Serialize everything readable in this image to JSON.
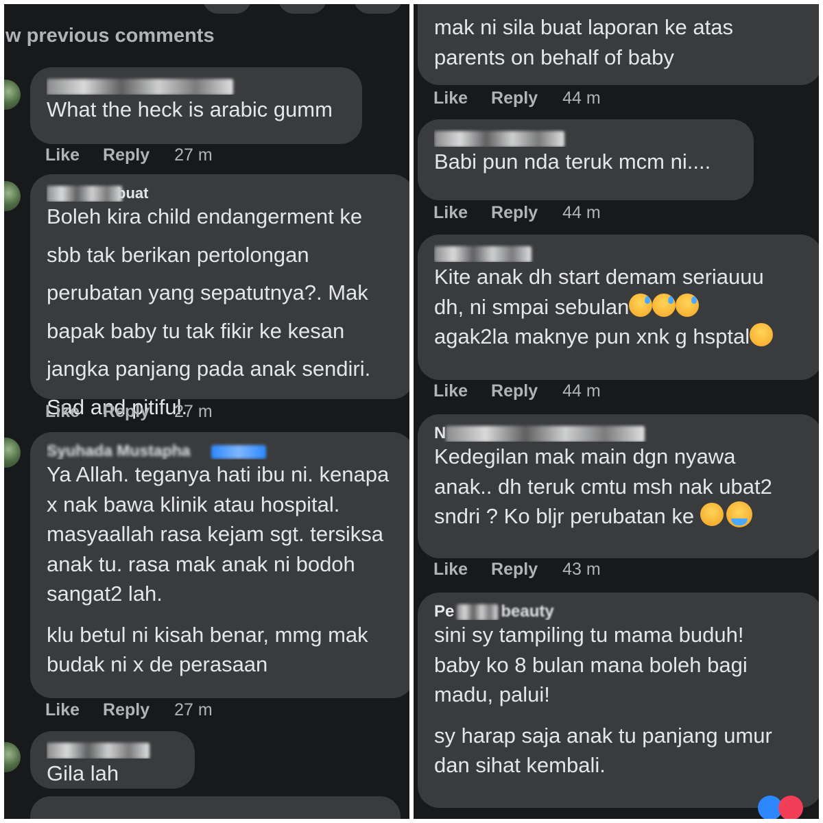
{
  "left": {
    "show_previous": "w previous comments",
    "comments": [
      {
        "text": [
          "What the heck is arabic gumm"
        ],
        "actions": {
          "like": "Like",
          "reply": "Reply",
          "time": "27 m"
        }
      },
      {
        "author_visible": "buat",
        "text": [
          "Boleh kira child endangerment ke",
          "sbb tak berikan pertolongan",
          "perubatan yang sepatutnya?. Mak",
          "bapak baby tu tak fikir ke kesan",
          "jangka panjang pada anak sendiri.",
          "Sad and pitiful."
        ],
        "actions": {
          "like": "Like",
          "reply": "Reply",
          "time": "27 m"
        }
      },
      {
        "author_visible": "Syuhada Mustapha",
        "text_p1": [
          "Ya Allah. teganya hati ibu ni. kenapa",
          "x nak bawa klinik atau hospital.",
          "masyaallah rasa kejam sgt. tersiksa",
          "anak tu. rasa mak anak ni bodoh",
          "sangat2 lah."
        ],
        "text_p2": [
          "klu betul ni kisah benar, mmg mak",
          "budak ni x de perasaan"
        ],
        "actions": {
          "like": "Like",
          "reply": "Reply",
          "time": "27 m"
        }
      },
      {
        "text": [
          "Gila lah"
        ]
      }
    ]
  },
  "right": {
    "comments": [
      {
        "text": [
          "mak ni sila buat laporan ke atas",
          "parents on behalf of baby"
        ],
        "actions": {
          "like": "Like",
          "reply": "Reply",
          "time": "44 m"
        }
      },
      {
        "text": [
          "Babi pun nda teruk mcm ni...."
        ],
        "actions": {
          "like": "Like",
          "reply": "Reply",
          "time": "44 m"
        }
      },
      {
        "text": [
          "Kite anak dh start demam seriauuu",
          "dh, ni smpai sebulan",
          "agak2la maknye pun xnk g hsptal"
        ],
        "actions": {
          "like": "Like",
          "reply": "Reply",
          "time": "44 m"
        }
      },
      {
        "author_visible": "N",
        "text": [
          "Kedegilan mak main dgn nyawa",
          "anak.. dh teruk cmtu msh nak ubat2",
          "sndri ? Ko bljr perubatan ke"
        ],
        "actions": {
          "like": "Like",
          "reply": "Reply",
          "time": "43 m"
        }
      },
      {
        "author_visible_a": "Pe",
        "author_visible_b": "beauty",
        "text_p1": [
          "sini sy tampiling tu mama buduh!",
          "baby ko 8 bulan mana boleh bagi",
          "madu, palui!"
        ],
        "text_p2": [
          "sy harap saja anak tu panjang umur",
          "dan sihat kembali."
        ]
      }
    ]
  },
  "icons": [
    "sweat-smile-emoji",
    "hugging-emoji",
    "relieved-emoji",
    "crying-emoji",
    "like-reaction-icon",
    "love-reaction-icon"
  ],
  "colors": {
    "background": "#18191a",
    "bubble": "#3a3b3c",
    "text": "#e4e6eb",
    "muted": "#b0b3b8",
    "link": "#2d88ff"
  }
}
